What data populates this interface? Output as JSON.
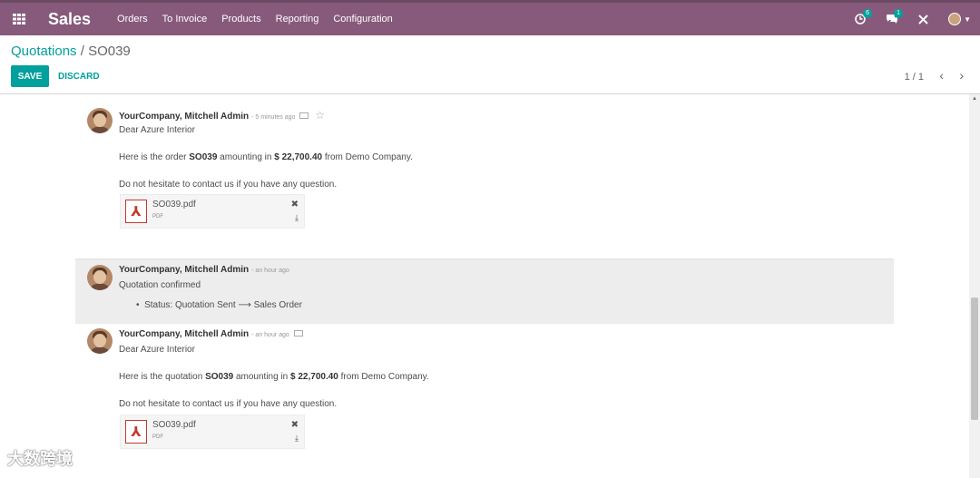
{
  "navbar": {
    "brand": "Sales",
    "menu": [
      "Orders",
      "To Invoice",
      "Products",
      "Reporting",
      "Configuration"
    ],
    "activity_count": "6",
    "message_count": "1"
  },
  "breadcrumb": {
    "parent": "Quotations",
    "separator": "/",
    "current": "SO039"
  },
  "buttons": {
    "save": "SAVE",
    "discard": "DISCARD"
  },
  "pager": {
    "value": "1 / 1"
  },
  "messages": [
    {
      "author": "YourCompany, Mitchell Admin",
      "date": "- 5 minutes ago",
      "greeting": "Dear Azure Interior",
      "body_pre": "Here is the order ",
      "body_ref": "SO039",
      "body_mid": " amounting in ",
      "body_amount": "$ 22,700.40",
      "body_post": " from Demo Company.",
      "closing": "Do not hesitate to contact us if you have any question.",
      "attachment": {
        "name": "SO039.pdf",
        "type": "PDF"
      }
    },
    {
      "author": "YourCompany, Mitchell Admin",
      "date": "- an hour ago",
      "text": "Quotation confirmed",
      "tracking": "Status: Quotation Sent ⟶ Sales Order"
    },
    {
      "author": "YourCompany, Mitchell Admin",
      "date": "- an hour ago",
      "greeting": "Dear Azure Interior",
      "body_pre": "Here is the quotation ",
      "body_ref": "SO039",
      "body_mid": " amounting in ",
      "body_amount": "$ 22,700.40",
      "body_post": " from Demo Company.",
      "closing": "Do not hesitate to contact us if you have any question.",
      "attachment": {
        "name": "SO039.pdf",
        "type": "PDF"
      }
    }
  ],
  "watermark": "大数跨境",
  "colors": {
    "navbar": "#875A7B",
    "accent": "#00A09D",
    "pdf": "#c0392b"
  }
}
